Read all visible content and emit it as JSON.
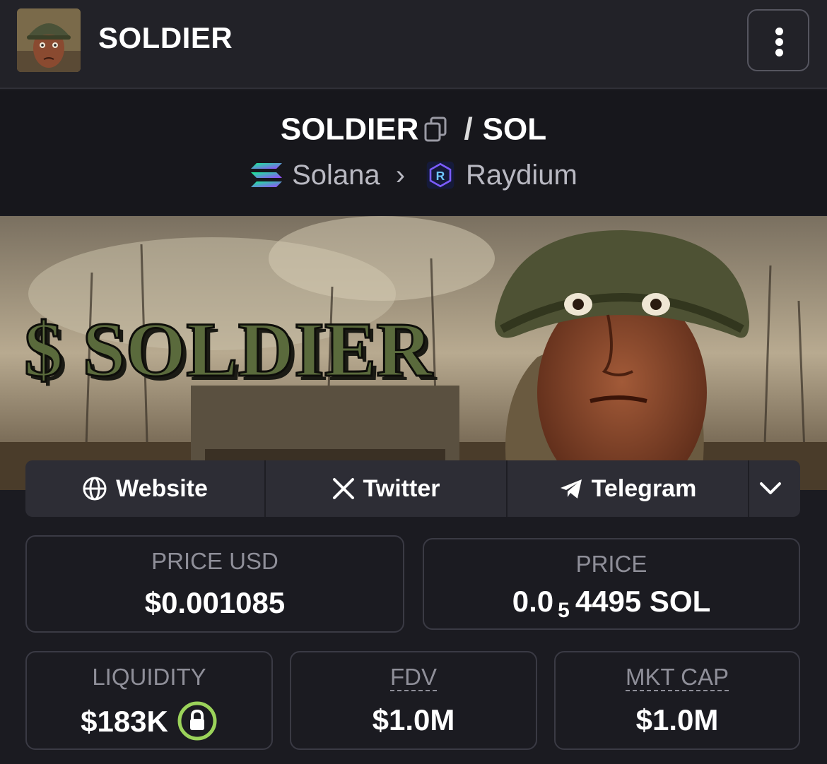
{
  "header": {
    "title": "SOLDIER",
    "avatar_icon": "soldier-avatar",
    "menu_icon": "vertical-dots-icon"
  },
  "pair": {
    "base": "SOLDIER",
    "separator": "/",
    "quote": "SOL",
    "chain": "Solana",
    "dex": "Raydium"
  },
  "banner": {
    "text": "$ SOLDIER"
  },
  "links": {
    "website": "Website",
    "twitter": "Twitter",
    "telegram": "Telegram"
  },
  "stats": {
    "price_usd_label": "PRICE USD",
    "price_usd_value": "$0.001085",
    "price_label": "PRICE",
    "price_value_prefix": "0.0",
    "price_value_zeros": "5",
    "price_value_digits": "4495 SOL",
    "liquidity_label": "LIQUIDITY",
    "liquidity_value": "$183K",
    "fdv_label": "FDV",
    "fdv_value": "$1.0M",
    "mktcap_label": "MKT CAP",
    "mktcap_value": "$1.0M"
  },
  "colors": {
    "background": "#1b1b21",
    "topbar": "#222228",
    "lock_ring": "#9bd35a",
    "muted_text": "#8f8f99"
  }
}
